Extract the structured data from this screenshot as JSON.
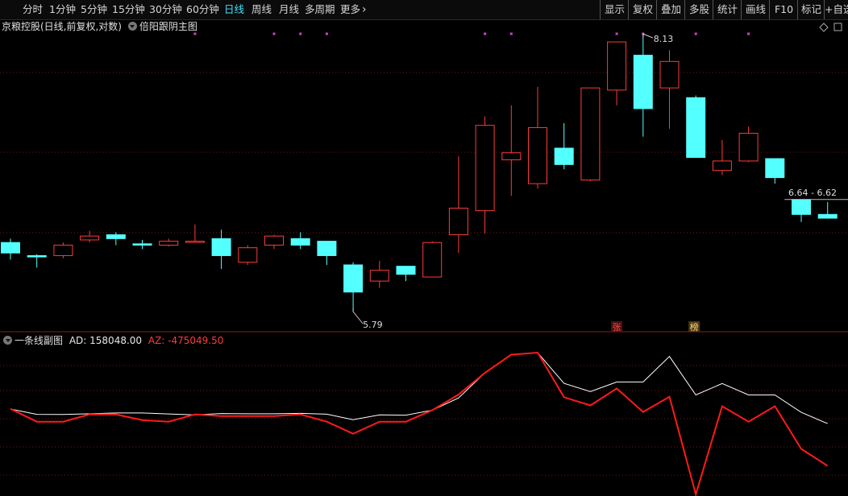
{
  "toolbar": {
    "periods": [
      {
        "label": "分时",
        "active": false
      },
      {
        "label": "1分钟",
        "active": false
      },
      {
        "label": "5分钟",
        "active": false
      },
      {
        "label": "15分钟",
        "active": false
      },
      {
        "label": "30分钟",
        "active": false
      },
      {
        "label": "60分钟",
        "active": false
      },
      {
        "label": "日线",
        "active": true
      },
      {
        "label": "周线",
        "active": false
      },
      {
        "label": "月线",
        "active": false
      },
      {
        "label": "多周期",
        "active": false
      },
      {
        "label": "更多",
        "active": false
      }
    ],
    "more_icon": "chevron-right-icon",
    "right_buttons": [
      "显示",
      "复权",
      "叠加",
      "多股",
      "统计",
      "画线",
      "F10",
      "标记",
      "+自选"
    ]
  },
  "main": {
    "title": "京粮控股(日线,前复权,对数)",
    "indicator": "倍阳跟阴主图",
    "markers": [
      {
        "text": "张",
        "color": "#ff4a4a",
        "bg": "#4a1212"
      },
      {
        "text": "榜",
        "color": "#ffd27a",
        "bg": "#4a3a12"
      }
    ],
    "annotations": {
      "low": "5.79",
      "high": "8.13",
      "range": "6.64 - 6.62"
    },
    "corner_icons": [
      "diamond-icon",
      "square-icon"
    ]
  },
  "sub": {
    "title": "一条线副图",
    "ad_label": "AD: 158048.00",
    "az_label": "AZ: -475049.50"
  },
  "colors": {
    "up": "#ff3a3a",
    "down": "#54ffff",
    "grid": "#7a1414",
    "dot": "#d040d0",
    "active": "#46e0f5",
    "ad_line": "#ffffff",
    "az_line": "#ff1a1a"
  },
  "chart_data": {
    "type": "candlestick",
    "candles": [
      {
        "o": 6.3,
        "c": 6.22,
        "h": 6.33,
        "l": 6.17
      },
      {
        "o": 6.2,
        "c": 6.19,
        "h": 6.21,
        "l": 6.11
      },
      {
        "o": 6.2,
        "c": 6.28,
        "h": 6.3,
        "l": 6.18
      },
      {
        "o": 6.32,
        "c": 6.35,
        "h": 6.39,
        "l": 6.3
      },
      {
        "o": 6.36,
        "c": 6.33,
        "h": 6.38,
        "l": 6.28
      },
      {
        "o": 6.29,
        "c": 6.28,
        "h": 6.32,
        "l": 6.25
      },
      {
        "o": 6.28,
        "c": 6.31,
        "h": 6.33,
        "l": 6.27
      },
      {
        "o": 6.31,
        "c": 6.31,
        "h": 6.44,
        "l": 6.3
      },
      {
        "o": 6.33,
        "c": 6.2,
        "h": 6.4,
        "l": 6.1
      },
      {
        "o": 6.15,
        "c": 6.26,
        "h": 6.28,
        "l": 6.13
      },
      {
        "o": 6.28,
        "c": 6.35,
        "h": 6.36,
        "l": 6.25
      },
      {
        "o": 6.33,
        "c": 6.28,
        "h": 6.38,
        "l": 6.25
      },
      {
        "o": 6.31,
        "c": 6.2,
        "h": 6.31,
        "l": 6.13
      },
      {
        "o": 6.13,
        "c": 5.93,
        "h": 6.15,
        "l": 5.79
      },
      {
        "o": 6.01,
        "c": 6.09,
        "h": 6.16,
        "l": 5.96
      },
      {
        "o": 6.12,
        "c": 6.06,
        "h": 6.12,
        "l": 6.01
      },
      {
        "o": 6.04,
        "c": 6.3,
        "h": 6.31,
        "l": 6.04
      },
      {
        "o": 6.36,
        "c": 6.57,
        "h": 7.0,
        "l": 6.22
      },
      {
        "o": 6.55,
        "c": 7.27,
        "h": 7.35,
        "l": 6.37
      },
      {
        "o": 6.97,
        "c": 7.03,
        "h": 7.45,
        "l": 6.67
      },
      {
        "o": 6.77,
        "c": 7.25,
        "h": 7.62,
        "l": 6.73
      },
      {
        "o": 7.07,
        "c": 6.93,
        "h": 7.29,
        "l": 6.89
      },
      {
        "o": 6.8,
        "c": 7.61,
        "h": 7.61,
        "l": 6.79
      },
      {
        "o": 7.59,
        "c": 8.05,
        "h": 8.05,
        "l": 7.45
      },
      {
        "o": 7.92,
        "c": 7.42,
        "h": 8.13,
        "l": 7.17
      },
      {
        "o": 7.61,
        "c": 7.86,
        "h": 7.97,
        "l": 7.24
      },
      {
        "o": 7.52,
        "c": 6.99,
        "h": 7.54,
        "l": 6.99
      },
      {
        "o": 6.88,
        "c": 6.96,
        "h": 7.14,
        "l": 6.84
      },
      {
        "o": 6.96,
        "c": 7.2,
        "h": 7.26,
        "l": 6.95
      },
      {
        "o": 6.98,
        "c": 6.82,
        "h": 6.98,
        "l": 6.77
      },
      {
        "o": 6.64,
        "c": 6.52,
        "h": 6.64,
        "l": 6.46
      },
      {
        "o": 6.52,
        "c": 6.49,
        "h": 6.62,
        "l": 6.49
      }
    ],
    "ad": [
      153000,
      114000,
      113000,
      118000,
      124000,
      124000,
      117000,
      110000,
      120000,
      118000,
      118000,
      121000,
      115000,
      75000,
      110000,
      108000,
      144000,
      235000,
      420000,
      554000,
      568000,
      342000,
      281000,
      352000,
      352000,
      540000,
      257000,
      341000,
      257000,
      257000,
      129000,
      46000
    ],
    "az": [
      155000,
      60000,
      60000,
      114000,
      114000,
      72000,
      60000,
      114000,
      101000,
      101000,
      101000,
      114000,
      60000,
      -28000,
      60000,
      60000,
      144000,
      260000,
      420000,
      554000,
      568000,
      240000,
      180000,
      304000,
      132000,
      243000,
      -475049,
      174000,
      60000,
      174000,
      -140000,
      -265000
    ]
  }
}
